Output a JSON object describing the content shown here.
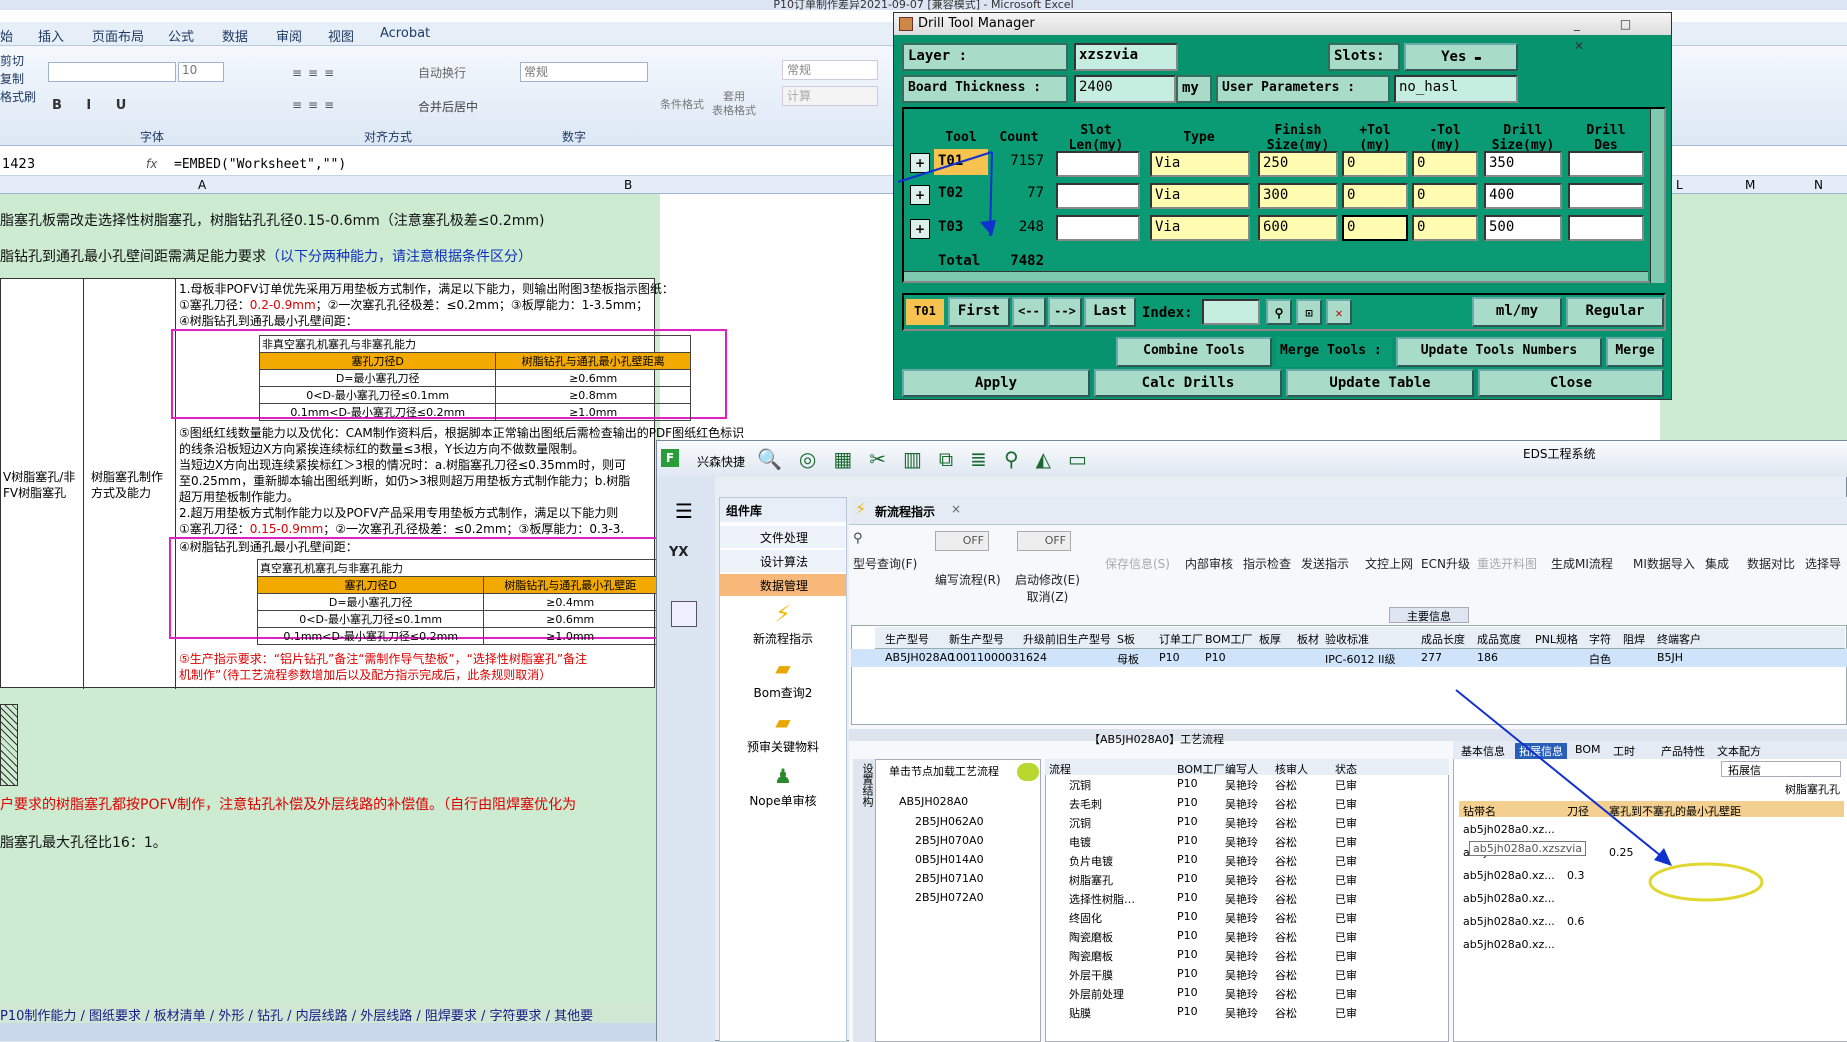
{
  "excel": {
    "title": "P10订单制作差异2021-09-07  [兼容模式] - Microsoft Excel",
    "tabs": [
      "始",
      "插入",
      "页面布局",
      "公式",
      "数据",
      "审阅",
      "视图",
      "Acrobat"
    ],
    "clipboard": [
      "剪切",
      "复制",
      "格式刷"
    ],
    "font_name": "",
    "font_size": "10",
    "wrap": "自动换行",
    "merge": "合并后居中",
    "number_format": "常规",
    "cond_format": "条件格式",
    "table_format": "套用\n表格格式",
    "style_normal": "常规",
    "style_calc": "计算",
    "groups": [
      "字体",
      "对齐方式",
      "数字"
    ],
    "name_box": "1423",
    "fx": "fx",
    "formula": "=EMBED(\"Worksheet\",\"\")",
    "col_a": "A",
    "col_b": "B",
    "col_l": "L",
    "col_m": "M",
    "col_n": "N",
    "line1": "脂塞孔板需改走选择性树脂塞孔，树脂钻孔孔径0.15-0.6mm（注意塞孔极差≤0.2mm)",
    "line2a": "脂钻孔到通孔最小孔壁间距需满足能力要求",
    "line2b": "（以下分两种能力，请注意根据条件区分）",
    "left_label": "V树脂塞孔/非\nFV树脂塞孔",
    "mid_label": "树脂塞孔制作\n方式及能力",
    "note1": "1.母板非POFV订单优先采用万用垫板方式制作，满足以下能力，则输出附图3垫板指示图纸：",
    "note2a": "①塞孔刀径：",
    "note2b": "0.2-0.9mm",
    "note2c": "；②一次塞孔孔径极差：≤0.2mm；③板厚能力：1-3.5mm；",
    "note3": "④树脂钻孔到通孔最小孔壁间距：",
    "t1_title": "非真空塞孔机塞孔与非塞孔能力",
    "t1_h1": "塞孔刀径D",
    "t1_h2": "树脂钻孔与通孔最小孔壁距离",
    "t1_rows": [
      [
        "D=最小塞孔刀径",
        "≥0.6mm"
      ],
      [
        "0<D-最小塞孔刀径≤0.1mm",
        "≥0.8mm"
      ],
      [
        "0.1mm<D-最小塞孔刀径≤0.2mm",
        "≥1.0mm"
      ]
    ],
    "note5": "⑤图纸红线数量能力以及优化：CAM制作资料后，根据脚本正常输出图纸后需检查输出的PDF图纸红色标识",
    "note6": "的线条沿板短边X方向紧挨连续标红的数量≤3根，Y长边方向不做数量限制。",
    "note7": "当短边X方向出现连续紧挨标红＞3根的情况时：a.树脂塞孔刀径≤0.35mm时，则可",
    "note8": "至0.25mm，重新脚本输出图纸判断，如仍>3根则超万用垫板方式制作能力；b.树脂",
    "note9": "超万用垫板制作能力。",
    "note10": "2.超万用垫板方式制作能力以及POFV产品采用专用垫板方式制作，满足以下能力则",
    "note11a": "①塞孔刀径：",
    "note11b": "0.15-0.9mm",
    "note11c": "；②一次塞孔孔径极差：≤0.2mm；③板厚能力：0.3-3.",
    "note12": "④树脂钻孔到通孔最小孔壁间距：",
    "t2_title": "真空塞孔机塞孔与非塞孔能力",
    "t2_h1": "塞孔刀径D",
    "t2_h2": "树脂钻孔与通孔最小孔壁距",
    "t2_rows": [
      [
        "D=最小塞孔刀径",
        "≥0.4mm"
      ],
      [
        "0<D-最小塞孔刀径≤0.1mm",
        "≥0.6mm"
      ],
      [
        "0.1mm<D-最小塞孔刀径≤0.2mm",
        "≥1.0mm"
      ]
    ],
    "note13": "⑤生产指示要求：“铝片钻孔”备注“需制作导气垫板”，“选择性树脂塞孔”备注",
    "note14": "机制作”（待工艺流程参数增加后以及配方指示完成后，此条规则取消）",
    "line3": "户要求的树脂塞孔都按POFV制作，注意钻孔补偿及外层线路的补偿值。（自行由阻焊塞优化为",
    "line4": "脂塞孔最大孔径比16：1。",
    "sheet_tabs": "P10制作能力 / 图纸要求 / 板材清单 / 外形 / 钻孔 / 内层线路 / 外层线路 / 阻焊要求 / 字符要求 / 其他要"
  },
  "dtm": {
    "title": "Drill Tool Manager",
    "layer_label": "Layer          :",
    "layer_value": "xzszvia",
    "slots_label": "Slots:",
    "slots_value": "Yes",
    "thickness_label": "Board Thickness :",
    "thickness_value": "2400",
    "thickness_unit": "my",
    "userparam_label": "User Parameters :",
    "userparam_value": "no_hasl",
    "headers": [
      "Tool",
      "Count",
      "Slot\nLen(my)",
      "Type",
      "Finish\nSize(my)",
      "+Tol\n(my)",
      "-Tol\n(my)",
      "Drill\nSize(my)",
      "Drill\nDes"
    ],
    "rows": [
      {
        "tool": "T01",
        "count": "7157",
        "type": "Via",
        "finish": "250",
        "ptol": "0",
        "ntol": "0",
        "drill": "350"
      },
      {
        "tool": "T02",
        "count": "77",
        "type": "Via",
        "finish": "300",
        "ptol": "0",
        "ntol": "0",
        "drill": "400"
      },
      {
        "tool": "T03",
        "count": "248",
        "type": "Via",
        "finish": "600",
        "ptol": "0",
        "ntol": "0",
        "drill": "500"
      }
    ],
    "total_label": "Total",
    "total_value": "7482",
    "current_tool": "T01",
    "first": "First",
    "prev": "<--",
    "next": "-->",
    "last": "Last",
    "index_label": "Index:",
    "unit": "ml/my",
    "mode": "Regular",
    "combine": "Combine Tools",
    "merge_label": "Merge Tools :",
    "update_numbers": "Update Tools Numbers",
    "merge": "Merge",
    "apply": "Apply",
    "calc": "Calc Drills",
    "update_table": "Update Table",
    "close": "Close"
  },
  "eds": {
    "title": "EDS工程系统",
    "app": "兴森快捷",
    "sys": "系统",
    "comp_title": "组件库",
    "comp_items": [
      "文件处理",
      "设计算法",
      "数据管理"
    ],
    "comp_icons": [
      "新流程指示",
      "Bom查询2",
      "预审关键物料",
      "Nope单审核"
    ],
    "tab_title": "新流程指示",
    "toolbar": [
      "型号查询(F)",
      "编写流程(R)",
      "启动修改(E)\n取消(Z)",
      "保存信息(S)",
      "内部审核",
      "指示检查",
      "发送指示",
      "文控上网",
      "ECN升级",
      "重选开料图",
      "生成MI流程",
      "MI数据导入",
      "集成",
      "数据对比",
      "选择导"
    ],
    "off": "OFF",
    "main_info": "主要信息",
    "grid_headers": [
      "生产型号",
      "新生产型号",
      "升级前旧生产型号",
      "S板",
      "订单工厂",
      "BOM工厂",
      "板厚",
      "板材",
      "验收标准",
      "成品长度",
      "成品宽度",
      "PNL规格",
      "字符",
      "阻焊",
      "终端客户"
    ],
    "grid_row": [
      "AB5JH028A0",
      "10011000031624",
      "",
      "母板",
      "P10",
      "P10",
      "",
      "",
      "IPC-6012 II级",
      "277",
      "186",
      "",
      "白色",
      "",
      "B5JH"
    ],
    "flow_title": "【AB5JH028A0】工艺流程",
    "side_tab": "设置结构",
    "flow_hint": "单击节点加载工艺流程",
    "tree_root": "AB5JH028A0",
    "tree_children": [
      "2B5JH062A0",
      "2B5JH070A0",
      "0B5JH014A0",
      "2B5JH071A0",
      "2B5JH072A0"
    ],
    "flow_headers": [
      "流程",
      "BOM工厂",
      "编写人",
      "核审人",
      "状态"
    ],
    "flow_rows": [
      [
        "沉铜",
        "P10",
        "吴艳玲",
        "谷松",
        "已审"
      ],
      [
        "去毛刺",
        "P10",
        "吴艳玲",
        "谷松",
        "已审"
      ],
      [
        "沉铜",
        "P10",
        "吴艳玲",
        "谷松",
        "已审"
      ],
      [
        "电镀",
        "P10",
        "吴艳玲",
        "谷松",
        "已审"
      ],
      [
        "负片电镀",
        "P10",
        "吴艳玲",
        "谷松",
        "已审"
      ],
      [
        "树脂塞孔",
        "P10",
        "吴艳玲",
        "谷松",
        "已审"
      ],
      [
        "选择性树脂…",
        "P10",
        "吴艳玲",
        "谷松",
        "已审"
      ],
      [
        "终固化",
        "P10",
        "吴艳玲",
        "谷松",
        "已审"
      ],
      [
        "陶瓷磨板",
        "P10",
        "吴艳玲",
        "谷松",
        "已审"
      ],
      [
        "陶瓷磨板",
        "P10",
        "吴艳玲",
        "谷松",
        "已审"
      ],
      [
        "外层干膜",
        "P10",
        "吴艳玲",
        "谷松",
        "已审"
      ],
      [
        "外层前处理",
        "P10",
        "吴艳玲",
        "谷松",
        "已审"
      ],
      [
        "贴膜",
        "P10",
        "吴艳玲",
        "谷松",
        "已审"
      ]
    ],
    "right_tabs": [
      "基本信息",
      "拓展信息",
      "BOM",
      "工时",
      "产品特性",
      "文本配方"
    ],
    "ext_btn": "拓展信",
    "ext_title": "树脂塞孔孔",
    "ext_headers": [
      "钻带名",
      "刀径",
      "塞孔到不塞孔的最小孔壁距"
    ],
    "ext_rows": [
      [
        "ab5jh028a0.xz...",
        "",
        ""
      ],
      [
        "ab5jh028a0.xz...",
        "25",
        "0.25"
      ],
      [
        "ab5jh028a0.xz...",
        "0.3",
        ""
      ],
      [
        "ab5jh028a0.xz...",
        "",
        ""
      ],
      [
        "ab5jh028a0.xz...",
        "0.6",
        ""
      ],
      [
        "ab5jh028a0.xz...",
        "",
        ""
      ]
    ],
    "tooltip": "ab5jh028a0.xzszvia"
  },
  "colors": {
    "dtm_bg": "#06936e",
    "field_yellow": "#fffbb0",
    "sheet_green": "#ccebd1",
    "eds_accent": "#ff8a00",
    "arrow": "#1030d0",
    "highlight": "#e8e040"
  }
}
